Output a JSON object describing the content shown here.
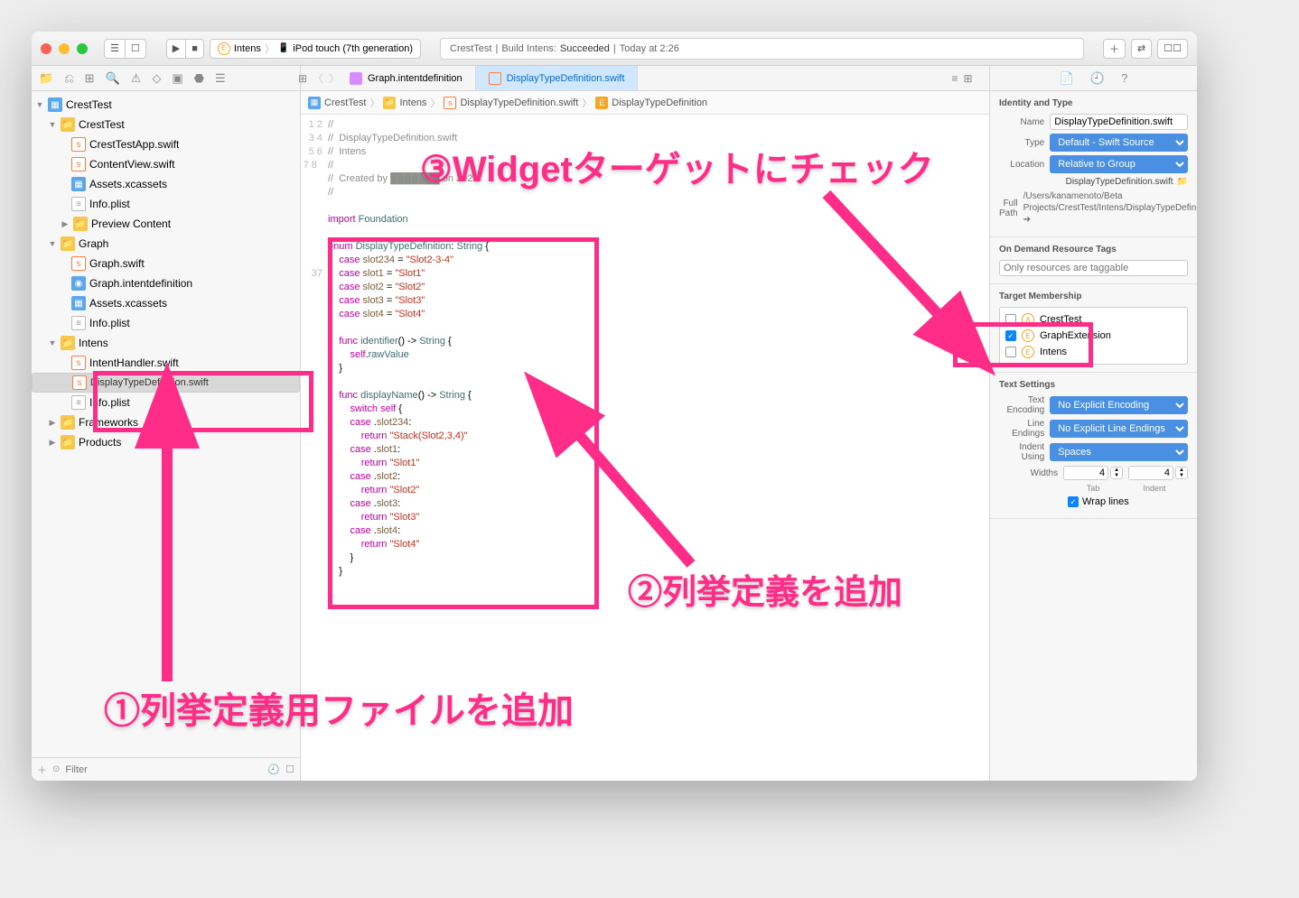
{
  "toolbar": {
    "scheme": "Intens",
    "device": "iPod touch (7th generation)",
    "status_project": "CrestTest",
    "status_action": "Build Intens:",
    "status_result": "Succeeded",
    "status_time": "Today at 2:26"
  },
  "tabs": {
    "left": "Graph.intentdefinition",
    "active": "DisplayTypeDefinition.swift"
  },
  "tree": {
    "root": "CrestTest",
    "g1": "CrestTest",
    "g1_items": [
      "CrestTestApp.swift",
      "ContentView.swift",
      "Assets.xcassets",
      "Info.plist",
      "Preview Content"
    ],
    "g2": "Graph",
    "g2_items": [
      "Graph.swift",
      "Graph.intentdefinition",
      "Assets.xcassets",
      "Info.plist"
    ],
    "g3": "Intens",
    "g3_items": [
      "IntentHandler.swift",
      "DisplayTypeDefinition.swift",
      "Info.plist"
    ],
    "g4": [
      "Frameworks",
      "Products"
    ]
  },
  "crumbs": [
    "CrestTest",
    "Intens",
    "DisplayTypeDefinition.swift",
    "DisplayTypeDefinition"
  ],
  "code_lines": [
    1,
    2,
    3,
    4,
    5,
    6,
    7,
    8,
    "",
    "",
    "",
    "",
    "",
    "",
    "",
    "",
    "",
    "",
    "",
    "",
    "",
    "",
    "",
    "",
    "",
    "",
    "",
    "",
    "",
    "",
    "",
    "",
    "",
    "",
    "",
    "",
    37
  ],
  "inspector": {
    "identity_title": "Identity and Type",
    "name_label": "Name",
    "name_val": "DisplayTypeDefinition.swift",
    "type_label": "Type",
    "type_val": "Default - Swift Source",
    "loc_label": "Location",
    "loc_val": "Relative to Group",
    "loc_file": "DisplayTypeDefinition.swift",
    "path_label": "Full Path",
    "path_val": "/Users/kanamenoto/Beta Projects/CrestTest/Intens/DisplayTypeDefinition.swift",
    "odr_title": "On Demand Resource Tags",
    "odr_ph": "Only resources are taggable",
    "tm_title": "Target Membership",
    "tm_items": [
      {
        "checked": false,
        "name": "CrestTest"
      },
      {
        "checked": true,
        "name": "GraphExtension"
      },
      {
        "checked": false,
        "name": "Intens"
      }
    ],
    "ts_title": "Text Settings",
    "enc_label": "Text Encoding",
    "enc_val": "No Explicit Encoding",
    "le_label": "Line Endings",
    "le_val": "No Explicit Line Endings",
    "ind_label": "Indent Using",
    "ind_val": "Spaces",
    "widths_label": "Widths",
    "tab_val": "4",
    "indent_val": "4",
    "tab_lbl": "Tab",
    "indent_lbl": "Indent",
    "wrap": "Wrap lines"
  },
  "filter_ph": "Filter",
  "annotations": {
    "a1": "①列挙定義用ファイルを追加",
    "a2": "②列挙定義を追加",
    "a3": "③Widgetターゲットにチェック"
  }
}
